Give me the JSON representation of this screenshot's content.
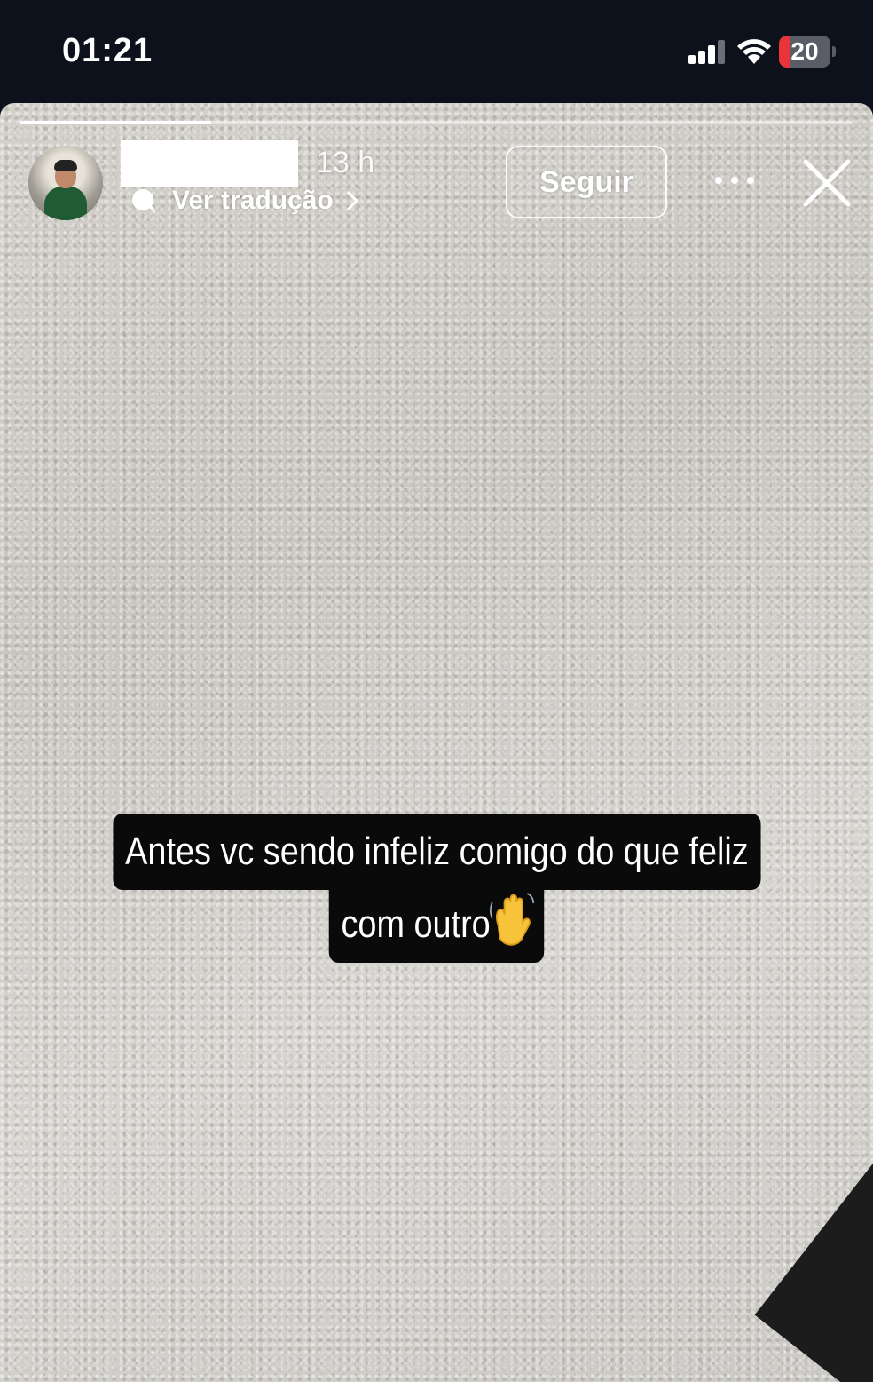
{
  "status_bar": {
    "time": "01:21",
    "battery": "20",
    "battery_fraction": 0.2,
    "battery_color": "#e9343a",
    "icons": [
      "signal-icon",
      "wifi-icon",
      "battery-icon"
    ]
  },
  "story": {
    "progress_fraction": 0.23,
    "header": {
      "time_ago": "13 h",
      "translate_label": "Ver tradução",
      "follow_label": "Seguir",
      "icons": [
        "avatar",
        "translate-icon",
        "chevron-right-icon",
        "more-icon",
        "close-icon"
      ]
    },
    "caption": {
      "line1": "Antes vc sendo infeliz comigo do que feliz",
      "line2": "com outro",
      "emoji_icon": "waving-hand-icon"
    }
  }
}
